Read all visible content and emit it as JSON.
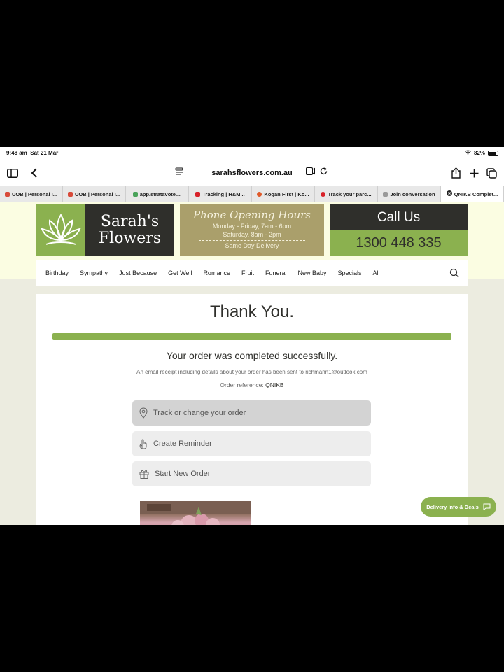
{
  "status_bar": {
    "time": "9:48 am",
    "date": "Sat 21 Mar",
    "battery": "82%"
  },
  "browser": {
    "url": "sarahsflowers.com.au",
    "tabs": [
      {
        "label": "UOB | Personal I...",
        "color": "#d84a3a"
      },
      {
        "label": "UOB | Personal I...",
        "color": "#d84a3a"
      },
      {
        "label": "app.stratavote....",
        "color": "#4aa35a"
      },
      {
        "label": "Tracking | H&M...",
        "color": "#d8222a"
      },
      {
        "label": "Kogan First | Ko...",
        "color": "#e05a2a"
      },
      {
        "label": "Track your parc...",
        "color": "#d8222a"
      },
      {
        "label": "Join conversation",
        "color": "#999999"
      },
      {
        "label": "QNIKB Complet...",
        "color": "#222222",
        "active": true
      }
    ]
  },
  "site": {
    "logo_line1": "Sarah's",
    "logo_line2": "Flowers",
    "hours_title": "Phone Opening Hours",
    "hours_weekday": "Monday - Friday, 7am - 6pm",
    "hours_saturday": "Saturday, 8am - 2pm",
    "hours_same_day": "Same Day Delivery",
    "call_label": "Call Us",
    "phone": "1300 448 335",
    "colors": {
      "green": "#8bb14f",
      "dark": "#2f2f2b",
      "khaki": "#aa9f6b"
    },
    "nav": [
      "Birthday",
      "Sympathy",
      "Just Because",
      "Get Well",
      "Romance",
      "Fruit",
      "Funeral",
      "New Baby",
      "Specials",
      "All"
    ]
  },
  "confirmation": {
    "heading": "Thank You.",
    "progress": 1.0,
    "success": "Your order was completed successfully.",
    "receipt": "An email receipt including details about your order has been sent to richmann1@outlook.com",
    "ref_label": "Order reference:",
    "ref_code": "QNIKB",
    "track_label": "Track or change your order",
    "reminder_label": "Create Reminder",
    "new_order_label": "Start New Order"
  },
  "deals_button": "Delivery Info & Deals"
}
